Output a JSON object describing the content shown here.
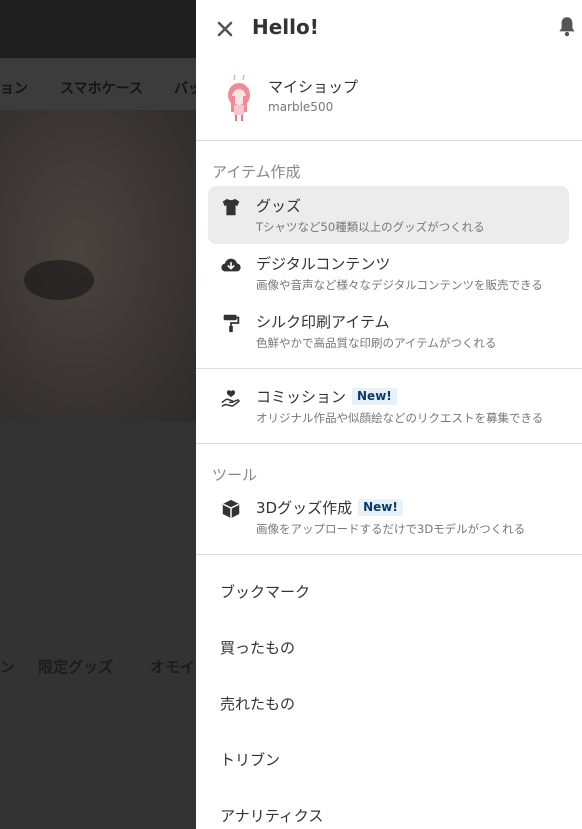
{
  "background": {
    "categories": [
      "ョン",
      "スマホケース",
      "バッ"
    ],
    "tags": [
      "ン",
      "限定グッズ",
      "オモイ"
    ]
  },
  "drawer": {
    "greeting": "Hello!",
    "shop": {
      "name": "マイショップ",
      "id": "marble500"
    },
    "sections": {
      "create_title": "アイテム作成",
      "tools_title": "ツール"
    },
    "items": {
      "goods": {
        "label": "グッズ",
        "desc": "Tシャツなど50種類以上のグッズがつくれる"
      },
      "digital": {
        "label": "デジタルコンテンツ",
        "desc": "画像や音声など様々なデジタルコンテンツを販売できる"
      },
      "silk": {
        "label": "シルク印刷アイテム",
        "desc": "色鮮やかで高品質な印刷のアイテムがつくれる"
      },
      "commission": {
        "label": "コミッション",
        "badge": "New!",
        "desc": "オリジナル作品や似顔絵などのリクエストを募集できる"
      },
      "goods3d": {
        "label": "3Dグッズ作成",
        "badge": "New!",
        "desc": "画像をアップロードするだけで3Dモデルがつくれる"
      }
    },
    "links": {
      "bookmark": "ブックマーク",
      "purchased": "買ったもの",
      "sold": "売れたもの",
      "tribune": "トリブン",
      "analytics": "アナリティクス"
    },
    "icons": {
      "close": "close-icon",
      "bell": "bell-icon",
      "goods": "tshirt-icon",
      "digital": "cloud-download-icon",
      "silk": "paint-roller-icon",
      "commission": "hand-heart-icon",
      "goods3d": "cube-icon"
    }
  }
}
